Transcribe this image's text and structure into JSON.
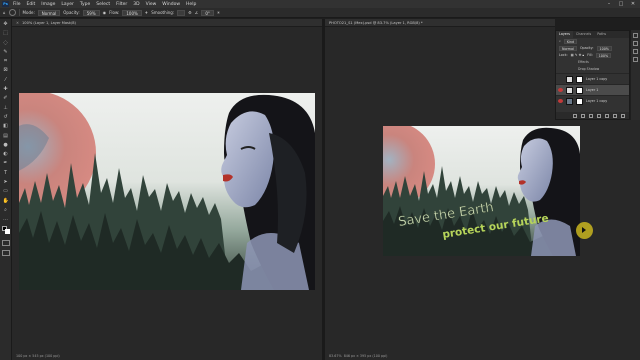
{
  "menubar": {
    "logo": "Ps",
    "items": [
      "File",
      "Edit",
      "Image",
      "Layer",
      "Type",
      "Select",
      "Filter",
      "3D",
      "View",
      "Window",
      "Help"
    ],
    "window_controls": [
      "–",
      "□",
      "✕"
    ]
  },
  "options_bar": {
    "mode_label": "Mode:",
    "mode_value": "Normal",
    "opacity_label": "Opacity:",
    "opacity_value": "59%",
    "flow_label": "Flow:",
    "flow_value": "100%",
    "smoothing_label": "Smoothing:",
    "angle_value": "0°"
  },
  "left_doc": {
    "tab_title": "100% (Layer 1, Layer Mask/8)",
    "status": "100 px × 545 px (100 ppi)"
  },
  "right_doc": {
    "tab_title": "PHOTO21_S1 (Mex).psd @ 83.7% (Layer 1, RGB/8) *",
    "zoom": "83.67%",
    "status": "846 px × 395 px (100 ppi)"
  },
  "artwork": {
    "headline": "Save the Earth",
    "subline": "protect our future"
  },
  "layers_panel": {
    "tabs": [
      "Layers",
      "Channels",
      "Paths"
    ],
    "kind_value": "Kind",
    "blend_value": "Normal",
    "opacity_label": "Opacity:",
    "opacity_value": "100%",
    "lock_label": "Lock:",
    "fill_label": "Fill:",
    "fill_value": "100%",
    "effects_label": "Effects",
    "effect_item": "Drop Shadow",
    "layers": [
      {
        "name": "Layer 1 copy",
        "visible": false,
        "selected": false
      },
      {
        "name": "Layer 1",
        "visible": true,
        "selected": true
      },
      {
        "name": "Layer 1 copy",
        "visible": true,
        "selected": false
      }
    ]
  },
  "colors": {
    "accent_eye": "#c23a3a",
    "text_green": "#b6d45a",
    "text_light": "#d8e8c0",
    "cursor_highlight": "#c8b41e"
  }
}
